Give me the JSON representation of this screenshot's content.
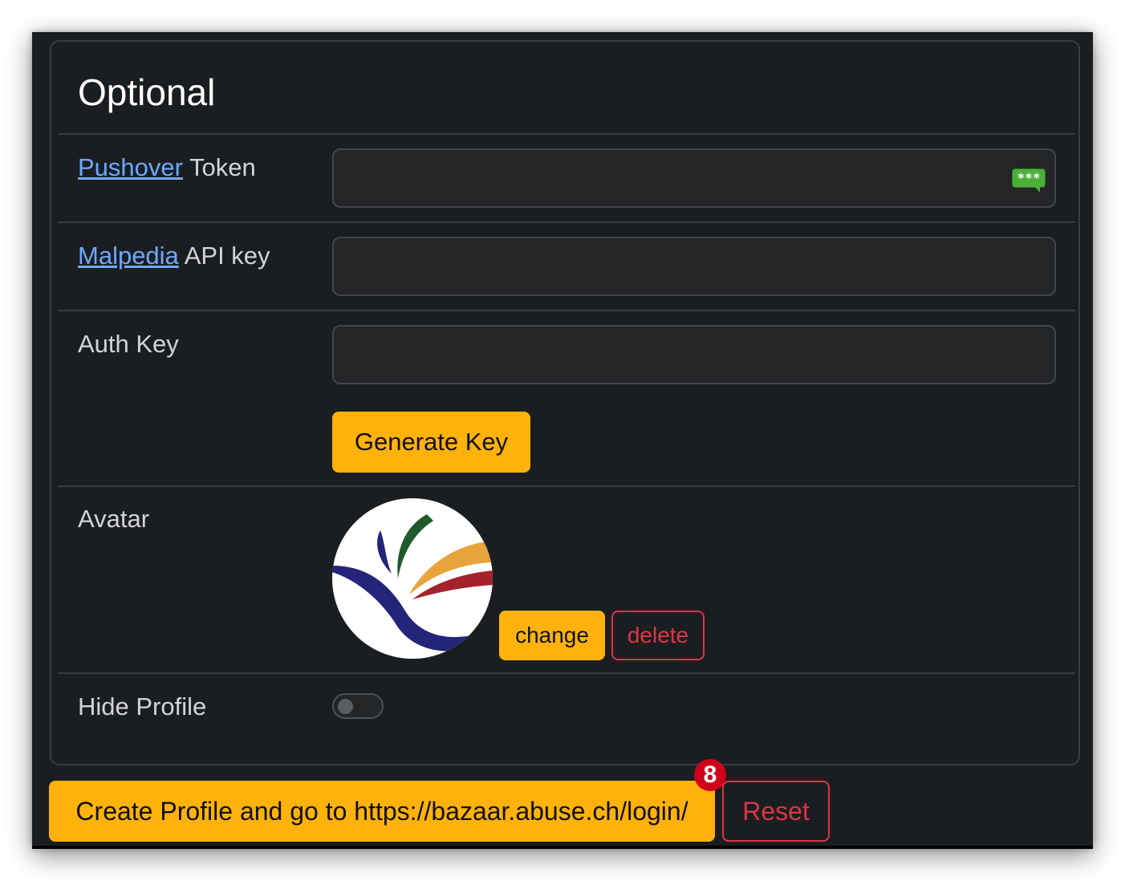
{
  "section": {
    "title": "Optional"
  },
  "fields": {
    "pushover": {
      "link_text": "Pushover",
      "label_rest": " Token",
      "value": "",
      "badge_text": "***"
    },
    "malpedia": {
      "link_text": "Malpedia",
      "label_rest": " API key",
      "value": ""
    },
    "auth_key": {
      "label": "Auth Key",
      "value": "",
      "generate_label": "Generate Key"
    },
    "avatar": {
      "label": "Avatar",
      "change_label": "change",
      "delete_label": "delete"
    },
    "hide_profile": {
      "label": "Hide Profile",
      "enabled": false
    }
  },
  "actions": {
    "create_label": "Create Profile and go to https://bazaar.abuse.ch/login/",
    "reset_label": "Reset",
    "badge_count": "8"
  },
  "colors": {
    "accent": "#ffb20c",
    "danger": "#dc3545",
    "link": "#6ea8fe",
    "background": "#1b1e21",
    "badge": "#d0021b",
    "password_badge": "#4cae3b"
  },
  "icons": {
    "avatar_logo": "malpedia-logo",
    "password_manager": "password-manager-icon"
  }
}
